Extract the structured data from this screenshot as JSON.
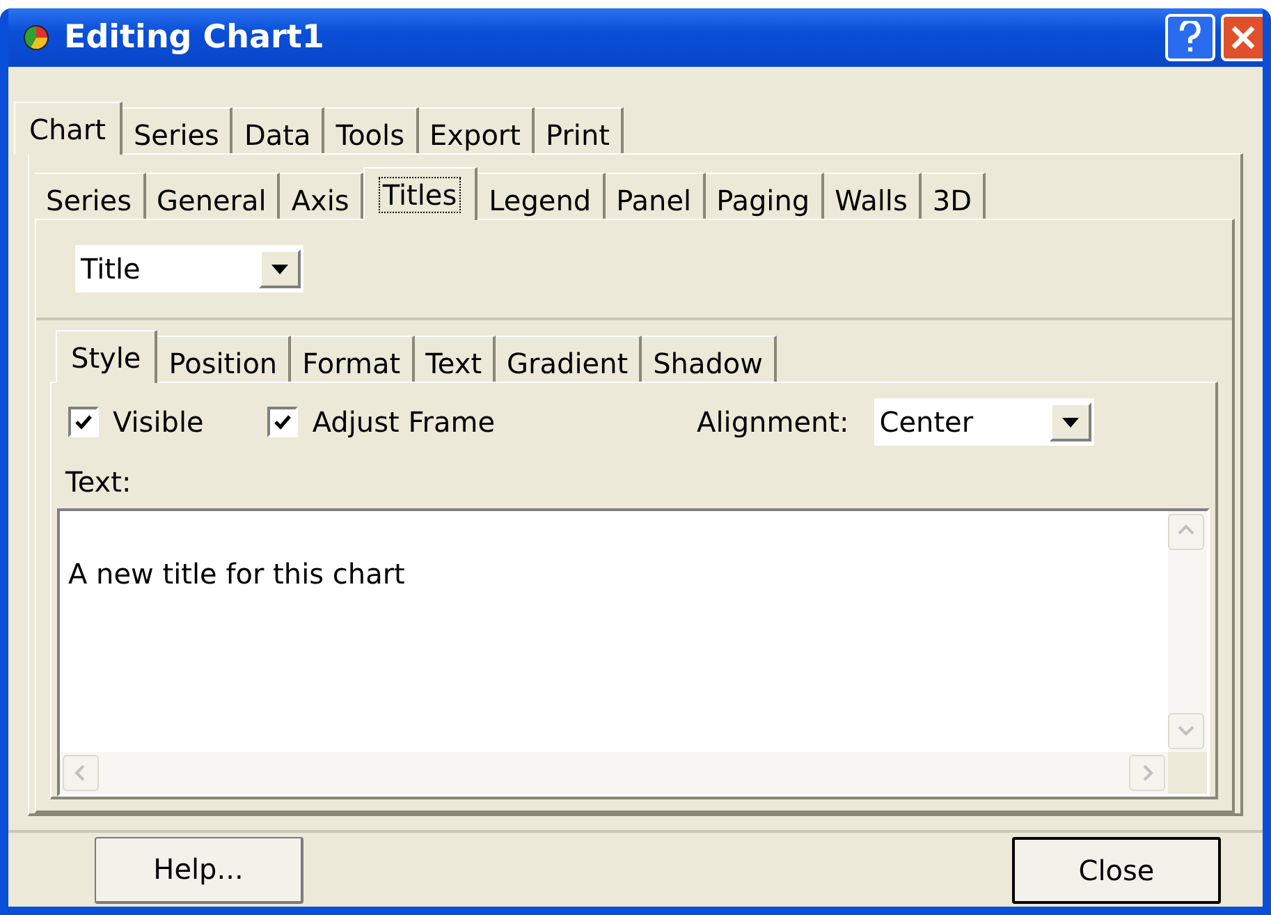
{
  "window": {
    "title": "Editing Chart1"
  },
  "main_tabs": [
    {
      "label": "Chart",
      "selected": true
    },
    {
      "label": "Series",
      "selected": false
    },
    {
      "label": "Data",
      "selected": false
    },
    {
      "label": "Tools",
      "selected": false
    },
    {
      "label": "Export",
      "selected": false
    },
    {
      "label": "Print",
      "selected": false
    }
  ],
  "chart_tabs": [
    {
      "label": "Series",
      "selected": false
    },
    {
      "label": "General",
      "selected": false
    },
    {
      "label": "Axis",
      "selected": false
    },
    {
      "label": "Titles",
      "selected": true
    },
    {
      "label": "Legend",
      "selected": false
    },
    {
      "label": "Panel",
      "selected": false
    },
    {
      "label": "Paging",
      "selected": false
    },
    {
      "label": "Walls",
      "selected": false
    },
    {
      "label": "3D",
      "selected": false
    }
  ],
  "title_select": {
    "value": "Title"
  },
  "title_tabs": [
    {
      "label": "Style",
      "selected": true
    },
    {
      "label": "Position",
      "selected": false
    },
    {
      "label": "Format",
      "selected": false
    },
    {
      "label": "Text",
      "selected": false
    },
    {
      "label": "Gradient",
      "selected": false
    },
    {
      "label": "Shadow",
      "selected": false
    }
  ],
  "checkboxes": [
    {
      "label": "Visible",
      "checked": true
    },
    {
      "label": "Adjust Frame",
      "checked": true
    }
  ],
  "alignment": {
    "label": "Alignment:",
    "value": "Center"
  },
  "text_label": {
    "label": "Text:"
  },
  "text_value": "A new title for this chart",
  "buttons": [
    {
      "label": "Help...",
      "default": false
    },
    {
      "label": "Close",
      "default": true
    }
  ]
}
